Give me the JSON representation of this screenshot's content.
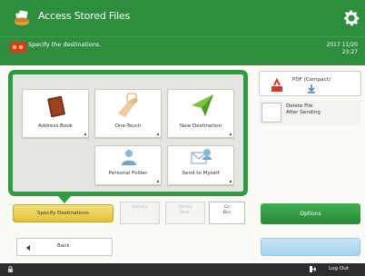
{
  "app": {
    "title": "Access Stored Files"
  },
  "status": {
    "message": "Specify the destinations.",
    "date": "2017 11/20",
    "time": "23:27"
  },
  "destinations": {
    "tiles": [
      {
        "label": "Address Book",
        "icon": "address-book-icon"
      },
      {
        "label": "One-Touch",
        "icon": "one-touch-icon"
      },
      {
        "label": "New Destination",
        "icon": "new-destination-icon"
      },
      {
        "label": "Personal Folder",
        "icon": "personal-folder-icon"
      },
      {
        "label": "Send to Myself",
        "icon": "send-to-myself-icon"
      }
    ]
  },
  "actions": {
    "specify": "Specify Destinations",
    "details": "Details",
    "delete": "Delete",
    "delete_sub": "Dest.",
    "scroll": "Cc",
    "scroll_sub": "Bcc",
    "options": "Options",
    "back": "Back"
  },
  "file_format": {
    "label": "PDF (Compact)"
  },
  "delete_after": {
    "line1": "Delete File",
    "line2": "After Sending"
  },
  "footer": {
    "logout": "Log Out"
  },
  "colors": {
    "brand_green": "#2d8f3e",
    "accent_yellow": "#e2c23a",
    "start_blue": "#a6d4ee"
  }
}
